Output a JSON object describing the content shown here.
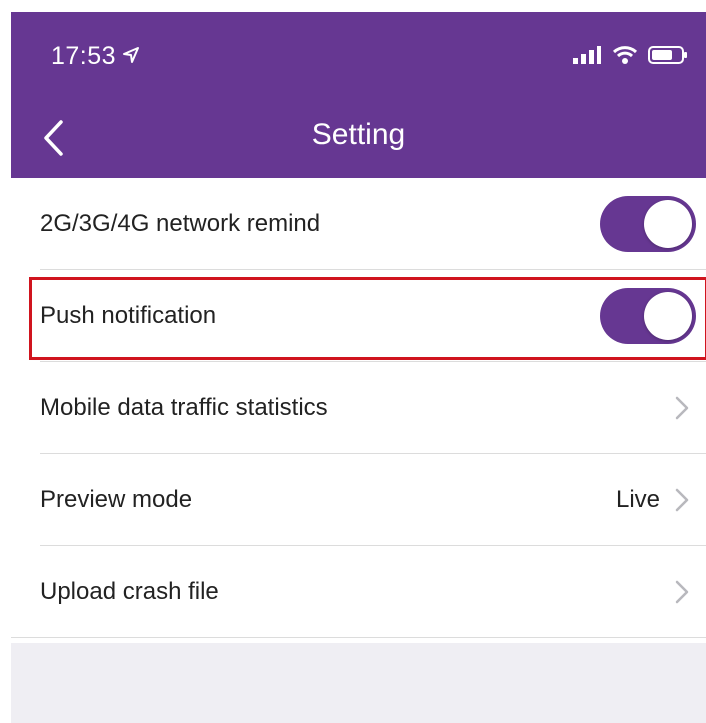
{
  "status_bar": {
    "time": "17:53",
    "icons": [
      "location-arrow-icon",
      "signal-bars-icon",
      "wifi-icon",
      "battery-icon"
    ]
  },
  "header": {
    "title": "Setting",
    "back_icon": "chevron-left-icon"
  },
  "settings": [
    {
      "label": "2G/3G/4G network remind",
      "control": "toggle",
      "state": "on"
    },
    {
      "label": "Push notification",
      "control": "toggle",
      "state": "on"
    },
    {
      "label": "Mobile data traffic statistics",
      "control": "chevron"
    },
    {
      "label": "Preview mode",
      "control": "chevron",
      "value": "Live"
    },
    {
      "label": "Upload crash file",
      "control": "chevron"
    }
  ],
  "colors": {
    "accent": "#663792",
    "highlight": "#d0141e",
    "background_gray": "#efeef3"
  }
}
